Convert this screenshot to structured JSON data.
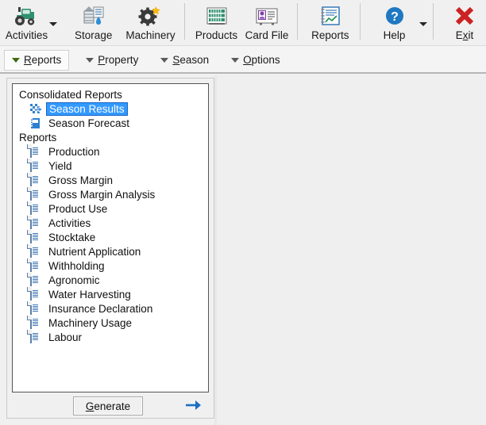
{
  "toolbar": {
    "items": [
      {
        "label": "Activities",
        "icon": "tractor-icon",
        "has_dropdown": true
      },
      {
        "label": "Storage",
        "icon": "silo-icon",
        "has_dropdown": false
      },
      {
        "label": "Machinery",
        "icon": "gear-icon",
        "has_dropdown": false
      },
      {
        "label": "Products",
        "icon": "shelf-icon",
        "has_dropdown": false
      },
      {
        "label": "Card File",
        "icon": "contact-card-icon",
        "has_dropdown": false
      },
      {
        "label": "Reports",
        "icon": "report-notebook-icon",
        "has_dropdown": false
      },
      {
        "label": "Help",
        "icon": "question-circle-icon",
        "has_dropdown": true
      },
      {
        "label": "Exit",
        "icon": "red-x-icon",
        "has_dropdown": false
      }
    ]
  },
  "menubar": {
    "items": [
      {
        "label_pre": "R",
        "label_key": "e",
        "label_post": "ports",
        "full": "Reports",
        "active": true,
        "caret": "green"
      },
      {
        "label_pre": "",
        "label_key": "P",
        "label_post": "roperty",
        "full": "Property",
        "active": false,
        "caret": "grey"
      },
      {
        "label_pre": "",
        "label_key": "S",
        "label_post": "eason",
        "full": "Season",
        "active": false,
        "caret": "grey"
      },
      {
        "label_pre": "",
        "label_key": "O",
        "label_post": "ptions",
        "full": "Options",
        "active": false,
        "caret": "grey"
      }
    ]
  },
  "tree": {
    "groups": [
      {
        "label": "Consolidated Reports",
        "items": [
          {
            "label": "Season Results",
            "icon": "season-results-icon",
            "selected": true
          },
          {
            "label": "Season Forecast",
            "icon": "season-forecast-icon",
            "selected": false
          }
        ]
      },
      {
        "label": "Reports",
        "items": [
          {
            "label": "Production",
            "icon": "document-icon",
            "selected": false
          },
          {
            "label": "Yield",
            "icon": "document-icon",
            "selected": false
          },
          {
            "label": "Gross Margin",
            "icon": "document-icon",
            "selected": false
          },
          {
            "label": "Gross Margin Analysis",
            "icon": "document-icon",
            "selected": false
          },
          {
            "label": "Product Use",
            "icon": "document-icon",
            "selected": false
          },
          {
            "label": "Activities",
            "icon": "document-icon",
            "selected": false
          },
          {
            "label": "Stocktake",
            "icon": "document-icon",
            "selected": false
          },
          {
            "label": "Nutrient Application",
            "icon": "document-icon",
            "selected": false
          },
          {
            "label": "Withholding",
            "icon": "document-icon",
            "selected": false
          },
          {
            "label": "Agronomic",
            "icon": "document-icon",
            "selected": false
          },
          {
            "label": "Water Harvesting",
            "icon": "document-icon",
            "selected": false
          },
          {
            "label": "Insurance Declaration",
            "icon": "document-icon",
            "selected": false
          },
          {
            "label": "Machinery Usage",
            "icon": "document-icon",
            "selected": false
          },
          {
            "label": "Labour",
            "icon": "document-icon",
            "selected": false
          }
        ]
      }
    ]
  },
  "actions": {
    "generate_pre": "",
    "generate_key": "G",
    "generate_post": "enerate",
    "generate_label": "Generate",
    "next_arrow_icon": "arrow-right-icon"
  },
  "colors": {
    "selection_blue": "#3399ff",
    "selection_border": "#1565c0",
    "menu_caret_green": "#3d6b12",
    "exit_red": "#cc2222",
    "help_blue": "#1f78c1",
    "arrow_blue": "#1a6fc4",
    "window_bg": "#f0f0f0",
    "panel_bg": "#efefef"
  }
}
